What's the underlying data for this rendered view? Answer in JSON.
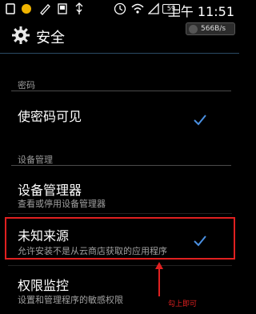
{
  "status_bar": {
    "time": "上午 11:51",
    "battery": "59"
  },
  "action_bar": {
    "title": "安全",
    "speed": "566B/s"
  },
  "sections": {
    "password_header": "密码",
    "device_admin_header": "设备管理"
  },
  "items": {
    "show_password": {
      "title": "使密码可见",
      "checked": true
    },
    "device_admins": {
      "title": "设备管理器",
      "subtitle": "查看或停用设备管理器"
    },
    "unknown_sources": {
      "title": "未知来源",
      "subtitle": "允许安装不是从云商店获取的应用程序",
      "checked": true
    },
    "permission_monitor": {
      "title": "权限监控",
      "subtitle": "设置和管理程序的敏感权限"
    }
  },
  "annotation": "勾上即可",
  "colors": {
    "highlight": "#e02020",
    "accent": "#4a90e2"
  },
  "icons": [
    "clock-icon",
    "wifi-icon",
    "gear-icon",
    "checkmark-icon"
  ]
}
